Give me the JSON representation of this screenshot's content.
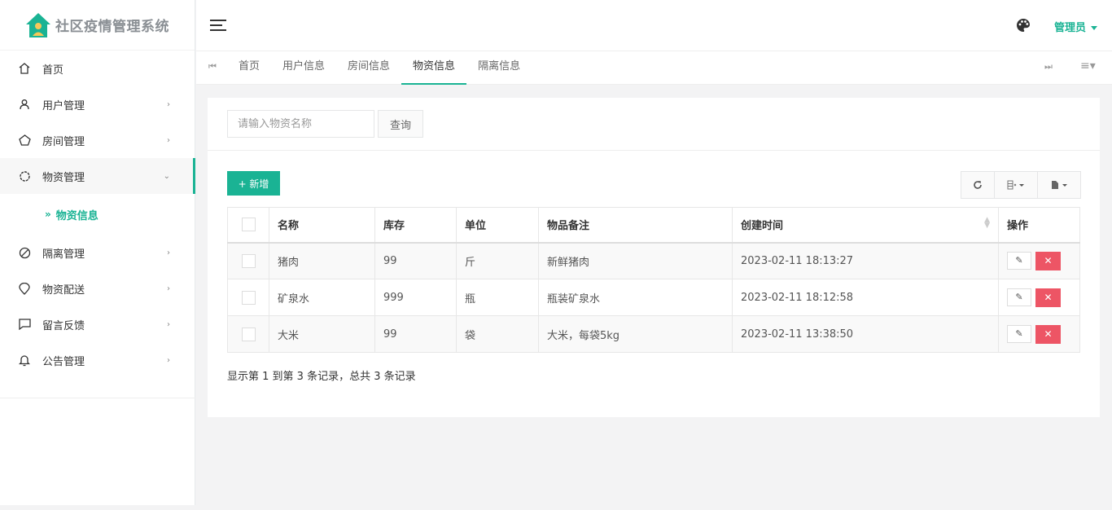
{
  "app": {
    "title": "社区疫情管理系统",
    "user_label": "管理员"
  },
  "sidebar": {
    "items": [
      {
        "label": "首页",
        "icon": "home-icon"
      },
      {
        "label": "用户管理",
        "icon": "user-icon"
      },
      {
        "label": "房间管理",
        "icon": "house-icon"
      },
      {
        "label": "物资管理",
        "icon": "gear-icon"
      },
      {
        "label": "隔离管理",
        "icon": "ban-icon"
      },
      {
        "label": "物资配送",
        "icon": "location-icon"
      },
      {
        "label": "留言反馈",
        "icon": "message-icon"
      },
      {
        "label": "公告管理",
        "icon": "bell-icon"
      }
    ],
    "sub_item": "物资信息"
  },
  "tabs": [
    "首页",
    "用户信息",
    "房间信息",
    "物资信息",
    "隔离信息"
  ],
  "search": {
    "placeholder": "请输入物资名称",
    "button": "查询"
  },
  "toolbar": {
    "add_label": "+ 新增"
  },
  "table": {
    "headers": [
      "名称",
      "库存",
      "单位",
      "物品备注",
      "创建时间",
      "操作"
    ],
    "rows": [
      {
        "name": "猪肉",
        "stock": "99",
        "unit": "斤",
        "note": "新鲜猪肉",
        "created": "2023-02-11 18:13:27"
      },
      {
        "name": "矿泉水",
        "stock": "999",
        "unit": "瓶",
        "note": "瓶装矿泉水",
        "created": "2023-02-11 18:12:58"
      },
      {
        "name": "大米",
        "stock": "99",
        "unit": "袋",
        "note": "大米，每袋5kg",
        "created": "2023-02-11 13:38:50"
      }
    ]
  },
  "pager": "显示第 1 到第 3 条记录，总共 3 条记录",
  "colors": {
    "accent": "#1ab394",
    "danger": "#ed5565"
  }
}
